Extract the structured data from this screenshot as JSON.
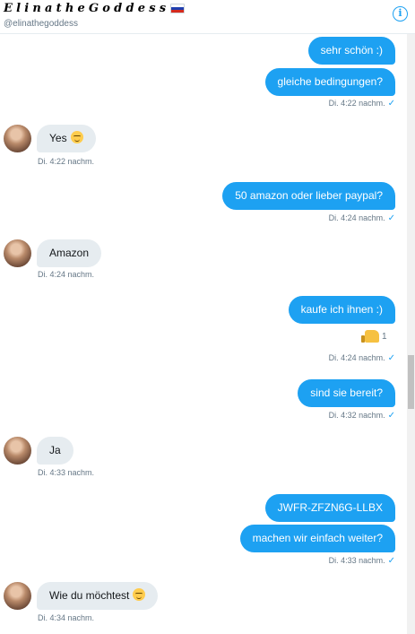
{
  "header": {
    "title": "ElinatheGoddess",
    "handle": "@elinathegoddess",
    "flag_icon": "russia-flag-icon",
    "info_icon": "info-icon",
    "info_glyph": "i"
  },
  "colors": {
    "outgoing_bubble": "#1da1f2",
    "incoming_bubble": "#e6ecf0",
    "meta_text": "#657786"
  },
  "messages": [
    {
      "dir": "out",
      "text": "sehr schön :)"
    },
    {
      "dir": "out",
      "text": "gleiche bedingungen?",
      "time": "Di. 4:22 nachm.",
      "read": true
    },
    {
      "dir": "in",
      "text": "Yes",
      "emoji": "relieved-face-emoji",
      "time": "Di. 4:22 nachm."
    },
    {
      "dir": "out",
      "text": "50 amazon oder lieber paypal?",
      "time": "Di. 4:24 nachm.",
      "read": true
    },
    {
      "dir": "in",
      "text": "Amazon",
      "time": "Di. 4:24 nachm."
    },
    {
      "dir": "out",
      "text": "kaufe ich ihnen :)",
      "reaction": {
        "icon": "thumbs-up-icon",
        "count": "1"
      },
      "time": "Di. 4:24 nachm.",
      "read": true
    },
    {
      "dir": "out",
      "text": "sind sie bereit?",
      "time": "Di. 4:32 nachm.",
      "read": true
    },
    {
      "dir": "in",
      "text": "Ja",
      "time": "Di. 4:33 nachm."
    },
    {
      "dir": "out",
      "text": "JWFR-ZFZN6G-LLBX"
    },
    {
      "dir": "out",
      "text": "machen wir einfach weiter?",
      "time": "Di. 4:33 nachm.",
      "read": true
    },
    {
      "dir": "in",
      "text": "Wie du möchtest",
      "emoji": "smirking-face-emoji",
      "time": "Di. 4:34 nachm."
    }
  ],
  "read_receipt": "✓"
}
